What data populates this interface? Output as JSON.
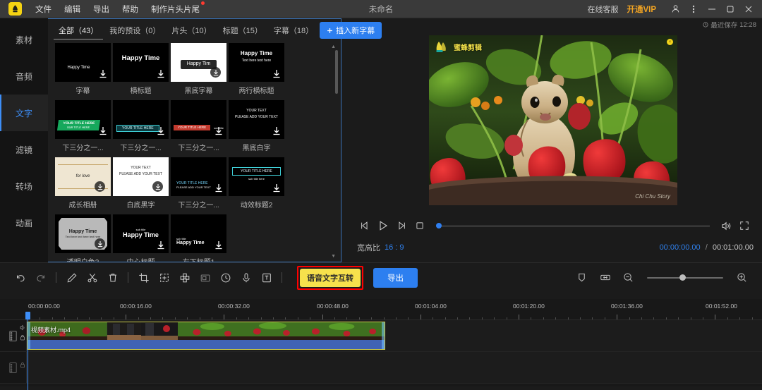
{
  "titlebar": {
    "logo_name": "bee-logo",
    "menu": [
      "文件",
      "编辑",
      "导出",
      "帮助",
      "制作片头片尾"
    ],
    "menu_badge_index": 4,
    "doc_title": "未命名",
    "support_link": "在线客服",
    "vip_link": "开通VIP",
    "window_buttons": [
      "minimize",
      "maximize",
      "close"
    ]
  },
  "save_status": {
    "label": "最近保存",
    "time": "12:28"
  },
  "sidebar": {
    "items": [
      {
        "label": "素材",
        "active": false
      },
      {
        "label": "音频",
        "active": false
      },
      {
        "label": "文字",
        "active": true
      },
      {
        "label": "滤镜",
        "active": false
      },
      {
        "label": "转场",
        "active": false
      },
      {
        "label": "动画",
        "active": false
      }
    ]
  },
  "media_panel": {
    "tabs": [
      {
        "label": "全部（43）",
        "active": true
      },
      {
        "label": "我的预设（0）",
        "active": false
      },
      {
        "label": "片头（10）",
        "active": false
      },
      {
        "label": "标题（15）",
        "active": false
      },
      {
        "label": "字幕（18）",
        "active": false
      }
    ],
    "insert_button": {
      "icon": "plus-icon",
      "label": "插入新字幕"
    },
    "templates": [
      {
        "caption": "字幕",
        "preview_text": "Happy Time",
        "style": "dark-small"
      },
      {
        "caption": "横标题",
        "preview_text": "Happy Time",
        "style": "dark-big"
      },
      {
        "caption": "黑底字幕",
        "preview_text": "Happy Tim",
        "style": "white-badge"
      },
      {
        "caption": "两行横标题",
        "preview_text": "Happy Time",
        "preview_sub": "Text here text here",
        "style": "dark-two"
      },
      {
        "caption": "下三分之一...",
        "preview_text": "YOUR TITLE HERE",
        "preview_sub": "SUB TITLE HERE",
        "style": "green-bar"
      },
      {
        "caption": "下三分之一...",
        "preview_text": "YOUR TITLE HERE",
        "preview_sub": "sub title",
        "style": "cyan-bar"
      },
      {
        "caption": "下三分之一...",
        "preview_text": "YOUR TITLE HERE",
        "preview_sub": "sub title",
        "style": "red-bar"
      },
      {
        "caption": "黑底白字",
        "preview_text": "YOUR TEXT",
        "preview_sub": "PLEASE ADD YOUR TEXT",
        "style": "dark-two-small"
      },
      {
        "caption": "成长相册",
        "preview_text": "for love",
        "style": "cream"
      },
      {
        "caption": "白底黑字",
        "preview_text": "YOUR TEXT",
        "preview_sub": "PLEASE ADD YOUR TEXT",
        "style": "white-two"
      },
      {
        "caption": "下三分之一...",
        "preview_text": "YOUR TITLE HERE",
        "preview_sub": "PLEASE ADD YOUR TEXT",
        "style": "dark-left"
      },
      {
        "caption": "动效标题2",
        "preview_text": "YOUR TITLE HERE",
        "preview_sub": "sub title here",
        "style": "box-outline"
      },
      {
        "caption": "透明白色2",
        "preview_text": "Happy Time",
        "preview_sub": "Text here text here text here",
        "style": "gray-plate"
      },
      {
        "caption": "中心标题",
        "preview_text": "Happy Time",
        "preview_sub": "sub title",
        "style": "dark-center"
      },
      {
        "caption": "左下标题1",
        "preview_text": "Happy Time",
        "preview_sub": "sub title",
        "style": "dark-bottomleft"
      }
    ],
    "scrollbar": {
      "up_arrow": "▲",
      "down_arrow": "▼"
    }
  },
  "preview": {
    "watermark_text": "蜜蜂剪辑",
    "watermark_icon": "bee-icon",
    "corner_badge": "×",
    "signature": "Chi Chu Story",
    "controls": [
      {
        "name": "prev-frame-button",
        "icon": "prev-frame-icon"
      },
      {
        "name": "play-button",
        "icon": "play-icon"
      },
      {
        "name": "next-frame-button",
        "icon": "next-frame-icon"
      },
      {
        "name": "stop-button",
        "icon": "stop-icon"
      }
    ],
    "right_controls": [
      {
        "name": "volume-button",
        "icon": "volume-icon"
      },
      {
        "name": "fullscreen-button",
        "icon": "fullscreen-icon"
      }
    ],
    "aspect_label": "宽高比",
    "aspect_value": "16 : 9",
    "current_time": "00:00:00.00",
    "time_separator": "/",
    "total_time": "00:01:00.00",
    "seek_progress_percent": 0
  },
  "toolbar": {
    "left_tools": [
      {
        "name": "undo-button",
        "icon": "undo-icon"
      },
      {
        "name": "redo-button",
        "icon": "redo-icon"
      },
      {
        "name": "divider-1",
        "icon": "divider"
      },
      {
        "name": "edit-button",
        "icon": "pencil-icon"
      },
      {
        "name": "split-button",
        "icon": "scissors-icon"
      },
      {
        "name": "delete-button",
        "icon": "trash-icon"
      },
      {
        "name": "divider-2",
        "icon": "divider"
      },
      {
        "name": "crop-button",
        "icon": "crop-icon"
      },
      {
        "name": "transform-button",
        "icon": "transform-icon"
      },
      {
        "name": "mosaic-button",
        "icon": "mosaic-icon"
      },
      {
        "name": "pip-button",
        "icon": "pip-icon"
      },
      {
        "name": "speed-button",
        "icon": "clock-icon"
      },
      {
        "name": "record-button",
        "icon": "microphone-icon"
      },
      {
        "name": "text-overlay-button",
        "icon": "text-box-icon"
      },
      {
        "name": "divider-3",
        "icon": "divider"
      }
    ],
    "highlighted_button": "语音文字互转",
    "export_button": "导出",
    "right_tools": [
      {
        "name": "marker-button",
        "icon": "marker-icon"
      },
      {
        "name": "fit-timeline-button",
        "icon": "fit-icon"
      },
      {
        "name": "zoom-out-button",
        "icon": "zoom-out-icon"
      },
      {
        "name": "zoom-in-button",
        "icon": "zoom-in-icon"
      }
    ],
    "zoom_slider_percent": 42
  },
  "timeline": {
    "ticks": [
      "00:00:00.00",
      "00:00:16.00",
      "00:00:32.00",
      "00:00:48.00",
      "00:01:04.00",
      "00:01:20.00",
      "00:01:36.00",
      "00:01:52.00"
    ],
    "playhead_time": "00:00:00.00",
    "tracks": [
      {
        "name": "video-track-1",
        "icons": [
          "film-icon",
          "volume-icon",
          "lock-icon"
        ],
        "clip": {
          "label": "视频素材.mp4",
          "selected": true
        }
      },
      {
        "name": "video-track-2",
        "icons": [
          "film-icon",
          "lock-icon"
        ],
        "clip": null
      }
    ]
  }
}
